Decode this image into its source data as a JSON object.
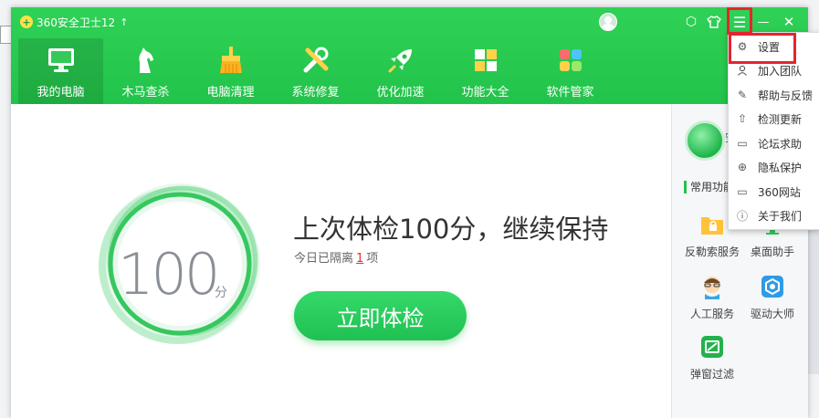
{
  "app": {
    "title": "360安全卫士12",
    "logo_glyph": "+",
    "up_glyph": "↑"
  },
  "window_controls": {
    "skin_glyph": "⬡",
    "shirt_glyph": "👕",
    "menu_glyph": "☰",
    "minimize_glyph": "—",
    "close_glyph": "✕"
  },
  "nav": [
    {
      "label": "我的电脑",
      "icon": "monitor-icon"
    },
    {
      "label": "木马查杀",
      "icon": "horse-icon"
    },
    {
      "label": "电脑清理",
      "icon": "broom-icon"
    },
    {
      "label": "系统修复",
      "icon": "tools-icon"
    },
    {
      "label": "优化加速",
      "icon": "rocket-icon"
    },
    {
      "label": "功能大全",
      "icon": "grid-icon"
    },
    {
      "label": "软件管家",
      "icon": "puzzle-icon"
    }
  ],
  "main": {
    "score": "100",
    "score_unit": "分",
    "headline": "上次体检100分，继续保持",
    "subline_prefix": "今日已隔离",
    "subline_count": "1",
    "subline_suffix": "项",
    "check_button": "立即体检"
  },
  "side": {
    "guard_text": "安",
    "common_label": "常用功能",
    "tools": [
      {
        "label": "反勒索服务",
        "icon": "folder-lock-icon"
      },
      {
        "label": "桌面助手",
        "icon": "desktop-helper-icon"
      },
      {
        "label": "人工服务",
        "icon": "agent-icon"
      },
      {
        "label": "驱动大师",
        "icon": "driver-icon"
      },
      {
        "label": "弹窗过滤",
        "icon": "popup-filter-icon"
      }
    ]
  },
  "menu": [
    {
      "label": "设置",
      "glyph": "⚙"
    },
    {
      "label": "加入团队",
      "glyph": "👤"
    },
    {
      "label": "帮助与反馈",
      "glyph": "✎"
    },
    {
      "label": "检测更新",
      "glyph": "⇧"
    },
    {
      "label": "论坛求助",
      "glyph": "▭"
    },
    {
      "label": "隐私保护",
      "glyph": "⊕"
    },
    {
      "label": "360网站",
      "glyph": "▭"
    },
    {
      "label": "关于我们",
      "glyph": "ⓘ"
    }
  ],
  "colors": {
    "brand_green": "#22c34a",
    "highlight_red": "#e3262d"
  }
}
